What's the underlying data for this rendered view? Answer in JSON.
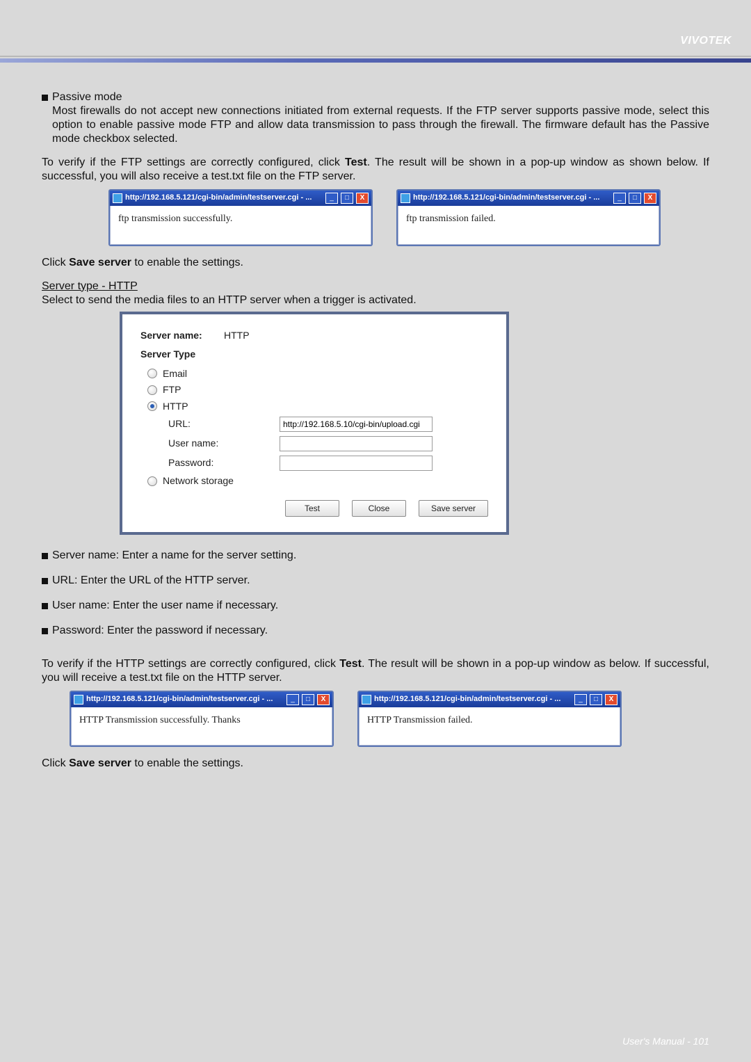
{
  "brand": "VIVOTEK",
  "section_passive": {
    "heading": "Passive mode",
    "body": "Most firewalls do not accept new connections initiated from external requests. If the FTP server supports passive mode, select this option to enable passive mode FTP and allow data transmission to pass through the firewall. The firmware default has the Passive mode checkbox selected."
  },
  "ftp_verify": {
    "pre": "To verify if the FTP settings are correctly configured, click ",
    "bold": "Test",
    "post": ". The result will be shown in a pop-up window as shown below. If successful, you will also receive a test.txt file on the FTP server."
  },
  "popup_titles": {
    "url": "http://192.168.5.121/cgi-bin/admin/testserver.cgi - ..."
  },
  "popup_ftp": {
    "success": "ftp transmission successfully.",
    "failed": "ftp transmission failed."
  },
  "save_server_note": {
    "pre": "Click ",
    "bold": "Save server",
    "post": " to enable the settings."
  },
  "http_section": {
    "heading": "Server type - HTTP",
    "desc": "Select to send the media files to an HTTP server when a trigger is activated."
  },
  "form": {
    "server_name_label": "Server name:",
    "server_name_value": "HTTP",
    "server_type_label": "Server Type",
    "options": {
      "email": "Email",
      "ftp": "FTP",
      "http": "HTTP",
      "network_storage": "Network storage"
    },
    "fields": {
      "url_label": "URL:",
      "url_value": "http://192.168.5.10/cgi-bin/upload.cgi",
      "user_label": "User name:",
      "user_value": "",
      "pass_label": "Password:",
      "pass_value": ""
    },
    "buttons": {
      "test": "Test",
      "close": "Close",
      "save": "Save server"
    }
  },
  "bullets": {
    "server_name": "Server name: Enter a name for the server setting.",
    "url": "URL: Enter the URL of the HTTP server.",
    "user": "User name: Enter the user name if necessary.",
    "password": "Password: Enter the password if necessary."
  },
  "http_verify": {
    "pre": "To verify if the HTTP settings are correctly configured, click ",
    "bold": "Test",
    "post": ". The result will be shown in a pop-up window as below. If successful, you will receive a test.txt file on the HTTP server."
  },
  "popup_http": {
    "success": "HTTP Transmission successfully. Thanks",
    "failed": "HTTP Transmission failed."
  },
  "footer": {
    "label": "User's Manual - ",
    "page": "101"
  }
}
